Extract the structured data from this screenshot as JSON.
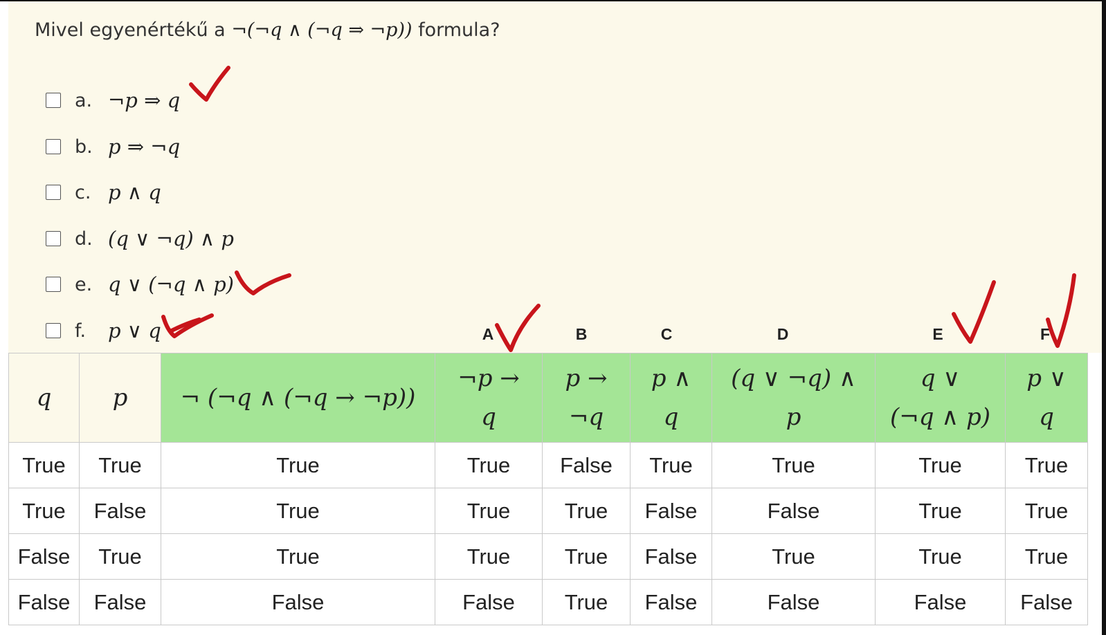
{
  "question": {
    "text": "Mivel egyenértékű a",
    "formula": "¬(¬q ∧ (¬q ⇒ ¬p))",
    "suffix": "formula?"
  },
  "options": [
    {
      "letter": "a.",
      "formula": "¬p ⇒ q",
      "checked": false
    },
    {
      "letter": "b.",
      "formula": "p ⇒ ¬q",
      "checked": false
    },
    {
      "letter": "c.",
      "formula": "p ∧ q",
      "checked": false
    },
    {
      "letter": "d.",
      "formula": "(q ∨ ¬q) ∧ p",
      "checked": false
    },
    {
      "letter": "e.",
      "formula": "q ∨ (¬q ∧ p)",
      "checked": false
    },
    {
      "letter": "f.",
      "formula": "p ∨ q",
      "checked": false
    }
  ],
  "column_letters": [
    "A",
    "B",
    "C",
    "D",
    "E",
    "F"
  ],
  "table": {
    "headers": [
      {
        "line1": "q",
        "line2": ""
      },
      {
        "line1": "p",
        "line2": ""
      },
      {
        "line1": "¬ (¬q ∧ (¬q → ¬p))",
        "line2": ""
      },
      {
        "line1": "¬p →",
        "line2": "q"
      },
      {
        "line1": "p →",
        "line2": "¬q"
      },
      {
        "line1": "p ∧",
        "line2": "q"
      },
      {
        "line1": "(q ∨ ¬q) ∧",
        "line2": "p"
      },
      {
        "line1": "q ∨",
        "line2": "(¬q ∧ p)"
      },
      {
        "line1": "p ∨",
        "line2": "q"
      }
    ],
    "rows": [
      [
        "True",
        "True",
        "True",
        "True",
        "False",
        "True",
        "True",
        "True",
        "True"
      ],
      [
        "True",
        "False",
        "True",
        "True",
        "True",
        "False",
        "False",
        "True",
        "True"
      ],
      [
        "False",
        "True",
        "True",
        "True",
        "True",
        "False",
        "True",
        "True",
        "True"
      ],
      [
        "False",
        "False",
        "False",
        "False",
        "True",
        "False",
        "False",
        "False",
        "False"
      ]
    ]
  },
  "colors": {
    "quiz_background": "#fcf9ea",
    "header_green": "#a4e596",
    "annotation_red": "#c8151b"
  }
}
